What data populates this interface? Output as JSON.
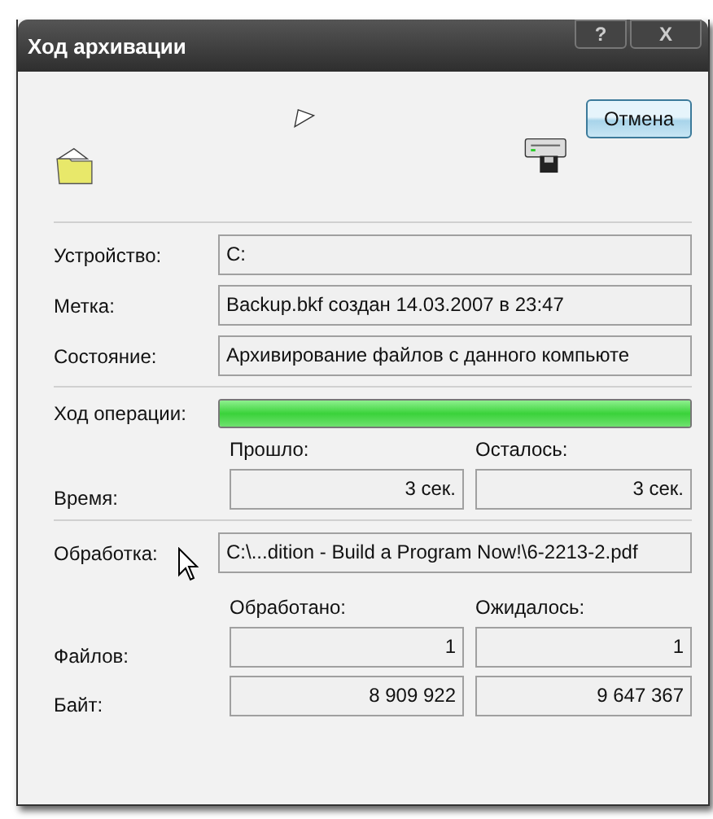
{
  "window": {
    "title": "Ход архивации",
    "help_button": "?",
    "close_button": "X"
  },
  "cancel_button": "Отмена",
  "info_rows": [
    {
      "label": "Устройство:",
      "value": "C:"
    },
    {
      "label": "Метка:",
      "value": "Backup.bkf создан 14.03.2007 в 23:47"
    },
    {
      "label": "Состояние:",
      "value": "Архивирование файлов с данного компьюте"
    }
  ],
  "progress": {
    "label": "Ход операции:",
    "level": 1.0
  },
  "time": {
    "label": "Время:",
    "column_labels": [
      "Прошло:",
      "Осталось:"
    ],
    "values": [
      "3 сек.",
      "3 сек."
    ]
  },
  "processing": {
    "label": "Обработка:",
    "value": "C:\\...dition - Build a Program Now!\\6-2213-2.pdf"
  },
  "counts": {
    "column_labels": [
      "Обработано:",
      "Ожидалось:"
    ],
    "rows": [
      {
        "label": "Файлов:",
        "values": [
          "1",
          "1"
        ]
      },
      {
        "label": "Байт:",
        "values": [
          "8 909 922",
          "9 647 367"
        ]
      }
    ]
  }
}
